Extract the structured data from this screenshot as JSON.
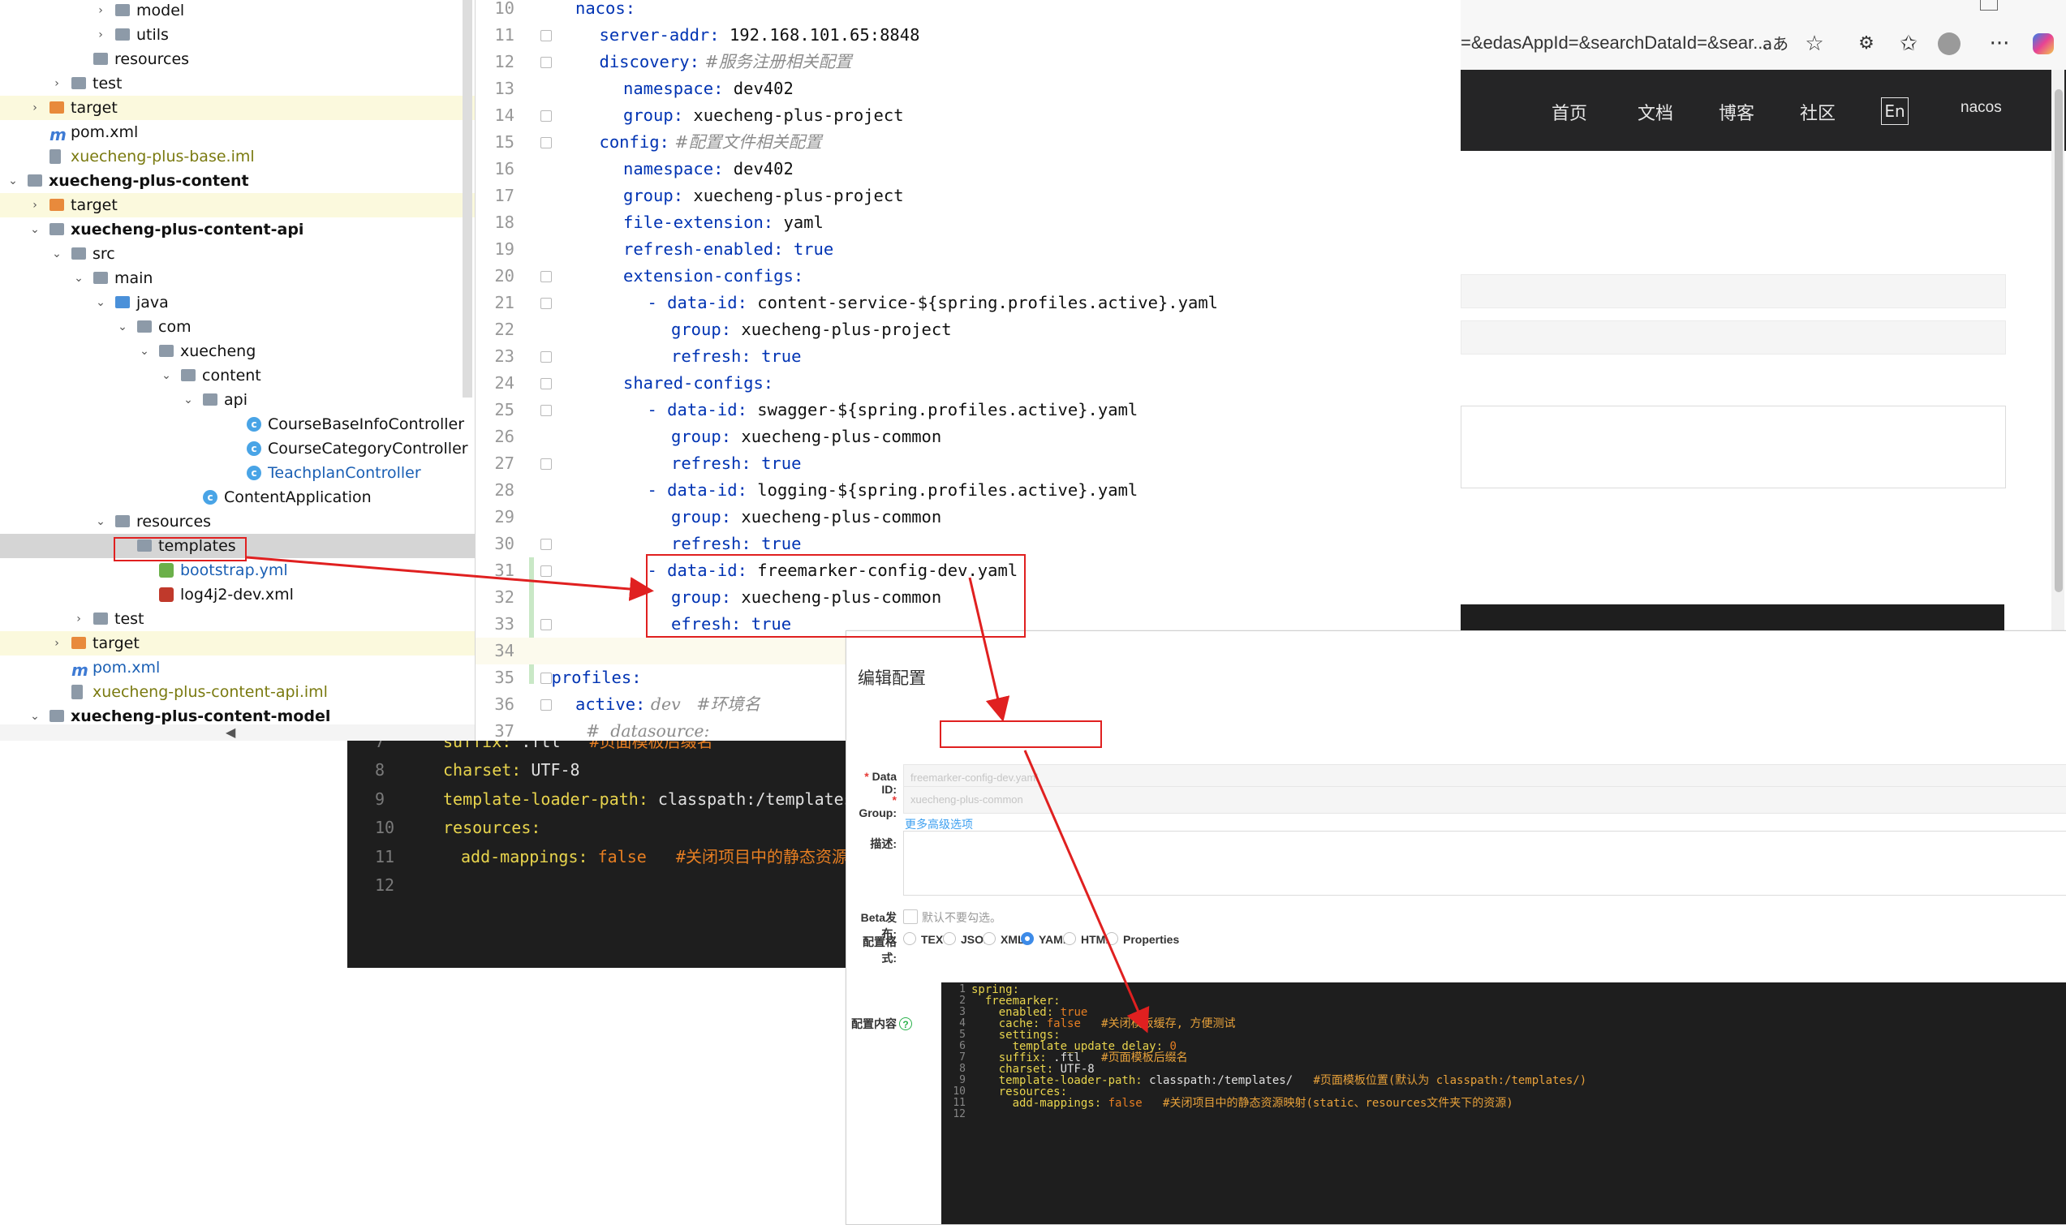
{
  "browser": {
    "address": "=&edasAppId=&searchDataId=&sear...",
    "nav": [
      "首页",
      "文档",
      "博客",
      "社区",
      "En",
      "nacos"
    ],
    "icons": [
      "read-aloud-icon",
      "star-icon",
      "extensions-icon",
      "favorites-icon",
      "profile-icon",
      "more-icon",
      "copilot-icon"
    ]
  },
  "tree": {
    "rows": [
      {
        "label": "model"
      },
      {
        "label": "utils"
      },
      {
        "label": "resources"
      },
      {
        "label": "test"
      },
      {
        "label": "target"
      },
      {
        "label": "pom.xml"
      },
      {
        "label": "xuecheng-plus-base.iml"
      },
      {
        "label": "xuecheng-plus-content"
      },
      {
        "label": "target"
      },
      {
        "label": "xuecheng-plus-content-api"
      },
      {
        "label": "src"
      },
      {
        "label": "main"
      },
      {
        "label": "java"
      },
      {
        "label": "com"
      },
      {
        "label": "xuecheng"
      },
      {
        "label": "content"
      },
      {
        "label": "api"
      },
      {
        "label": "CourseBaseInfoController"
      },
      {
        "label": "CourseCategoryController"
      },
      {
        "label": "TeachplanController"
      },
      {
        "label": "ContentApplication"
      },
      {
        "label": "resources"
      },
      {
        "label": "templates"
      },
      {
        "label": "bootstrap.yml"
      },
      {
        "label": "log4j2-dev.xml"
      },
      {
        "label": "test"
      },
      {
        "label": "target"
      },
      {
        "label": "pom.xml"
      },
      {
        "label": "xuecheng-plus-content-api.iml"
      },
      {
        "label": "xuecheng-plus-content-model"
      }
    ]
  },
  "yaml": {
    "lines": [
      {
        "n": "10",
        "k": "nacos:",
        "v": ""
      },
      {
        "n": "11",
        "k": "server-addr:",
        "v": " 192.168.101.65:8848"
      },
      {
        "n": "12",
        "k": "discovery:",
        "v": " #服务注册相关配置"
      },
      {
        "n": "13",
        "k": "namespace:",
        "v": " dev402"
      },
      {
        "n": "14",
        "k": "group:",
        "v": " xuecheng-plus-project"
      },
      {
        "n": "15",
        "k": "config:",
        "v": " #配置文件相关配置"
      },
      {
        "n": "16",
        "k": "namespace:",
        "v": " dev402"
      },
      {
        "n": "17",
        "k": "group:",
        "v": " xuecheng-plus-project"
      },
      {
        "n": "18",
        "k": "file-extension:",
        "v": " yaml"
      },
      {
        "n": "19",
        "k": "refresh-enabled:",
        "v": " true"
      },
      {
        "n": "20",
        "k": "extension-configs:",
        "v": ""
      },
      {
        "n": "21",
        "k": "- data-id:",
        "v": " content-service-${spring.profiles.active}.yaml"
      },
      {
        "n": "22",
        "k": "group:",
        "v": " xuecheng-plus-project"
      },
      {
        "n": "23",
        "k": "refresh:",
        "v": " true"
      },
      {
        "n": "24",
        "k": "shared-configs:",
        "v": ""
      },
      {
        "n": "25",
        "k": "- data-id:",
        "v": " swagger-${spring.profiles.active}.yaml"
      },
      {
        "n": "26",
        "k": "group:",
        "v": " xuecheng-plus-common"
      },
      {
        "n": "27",
        "k": "refresh:",
        "v": " true"
      },
      {
        "n": "28",
        "k": "- data-id:",
        "v": " logging-${spring.profiles.active}.yaml"
      },
      {
        "n": "29",
        "k": "group:",
        "v": " xuecheng-plus-common"
      },
      {
        "n": "30",
        "k": "refresh:",
        "v": " true"
      },
      {
        "n": "31",
        "k": "- data-id:",
        "v": " freemarker-config-dev.yaml"
      },
      {
        "n": "32",
        "k": "group:",
        "v": " xuecheng-plus-common"
      },
      {
        "n": "33",
        "k": "efresh:",
        "v": " true"
      },
      {
        "n": "34",
        "k": "",
        "v": ""
      },
      {
        "n": "35",
        "k": "profiles:",
        "v": ""
      },
      {
        "n": "36",
        "k": "active:",
        "v": " dev   #环境名"
      },
      {
        "n": "37",
        "k": "#  datasource:",
        "v": ""
      }
    ]
  },
  "dark_editor": {
    "lines": [
      {
        "n": "7",
        "k": "suffix:",
        "v": " .ftl",
        "c": "   #页面模板后缀名"
      },
      {
        "n": "8",
        "k": "charset:",
        "v": " UTF-8",
        "c": ""
      },
      {
        "n": "9",
        "k": "template-loader-path:",
        "v": " classpath:/templates/",
        "c": ""
      },
      {
        "n": "10",
        "k": "resources:",
        "v": "",
        "c": ""
      },
      {
        "n": "11",
        "k": "add-mappings:",
        "v": " false",
        "c": "   #关闭项目中的静态资源"
      },
      {
        "n": "12",
        "k": "",
        "v": "",
        "c": ""
      }
    ]
  },
  "nacos": {
    "title": "编辑配置",
    "data_id_label": "Data ID:",
    "data_id_value": "freemarker-config-dev.yaml",
    "group_label": "Group:",
    "group_value": "xuecheng-plus-common",
    "more_options": "更多高级选项",
    "desc_label": "描述:",
    "beta_label": "Beta发布:",
    "beta_hint": "默认不要勾选。",
    "format_label": "配置格式:",
    "formats": [
      "TEXT",
      "JSON",
      "XML",
      "YAML",
      "HTML",
      "Properties"
    ],
    "selected_format": "YAML",
    "content_label": "配置内容",
    "code": [
      {
        "n": "1",
        "k": "spring:",
        "v": "",
        "c": ""
      },
      {
        "n": "2",
        "k": "  freemarker:",
        "v": "",
        "c": ""
      },
      {
        "n": "3",
        "k": "    enabled:",
        "v": " true",
        "c": ""
      },
      {
        "n": "4",
        "k": "    cache:",
        "v": " false",
        "c": "   #关闭模板缓存, 方便测试"
      },
      {
        "n": "5",
        "k": "    settings:",
        "v": "",
        "c": ""
      },
      {
        "n": "6",
        "k": "      template_update_delay:",
        "v": " 0",
        "c": ""
      },
      {
        "n": "7",
        "k": "    suffix:",
        "v": " .ftl",
        "c": "   #页面模板后缀名"
      },
      {
        "n": "8",
        "k": "    charset:",
        "v": " UTF-8",
        "c": ""
      },
      {
        "n": "9",
        "k": "    template-loader-path:",
        "v": " classpath:/templates/",
        "c": "   #页面模板位置(默认为 classpath:/templates/)"
      },
      {
        "n": "10",
        "k": "    resources:",
        "v": "",
        "c": ""
      },
      {
        "n": "11",
        "k": "      add-mappings:",
        "v": " false",
        "c": "   #关闭项目中的静态资源映射(static、resources文件夹下的资源)"
      },
      {
        "n": "12",
        "k": "",
        "v": "",
        "c": ""
      }
    ]
  }
}
